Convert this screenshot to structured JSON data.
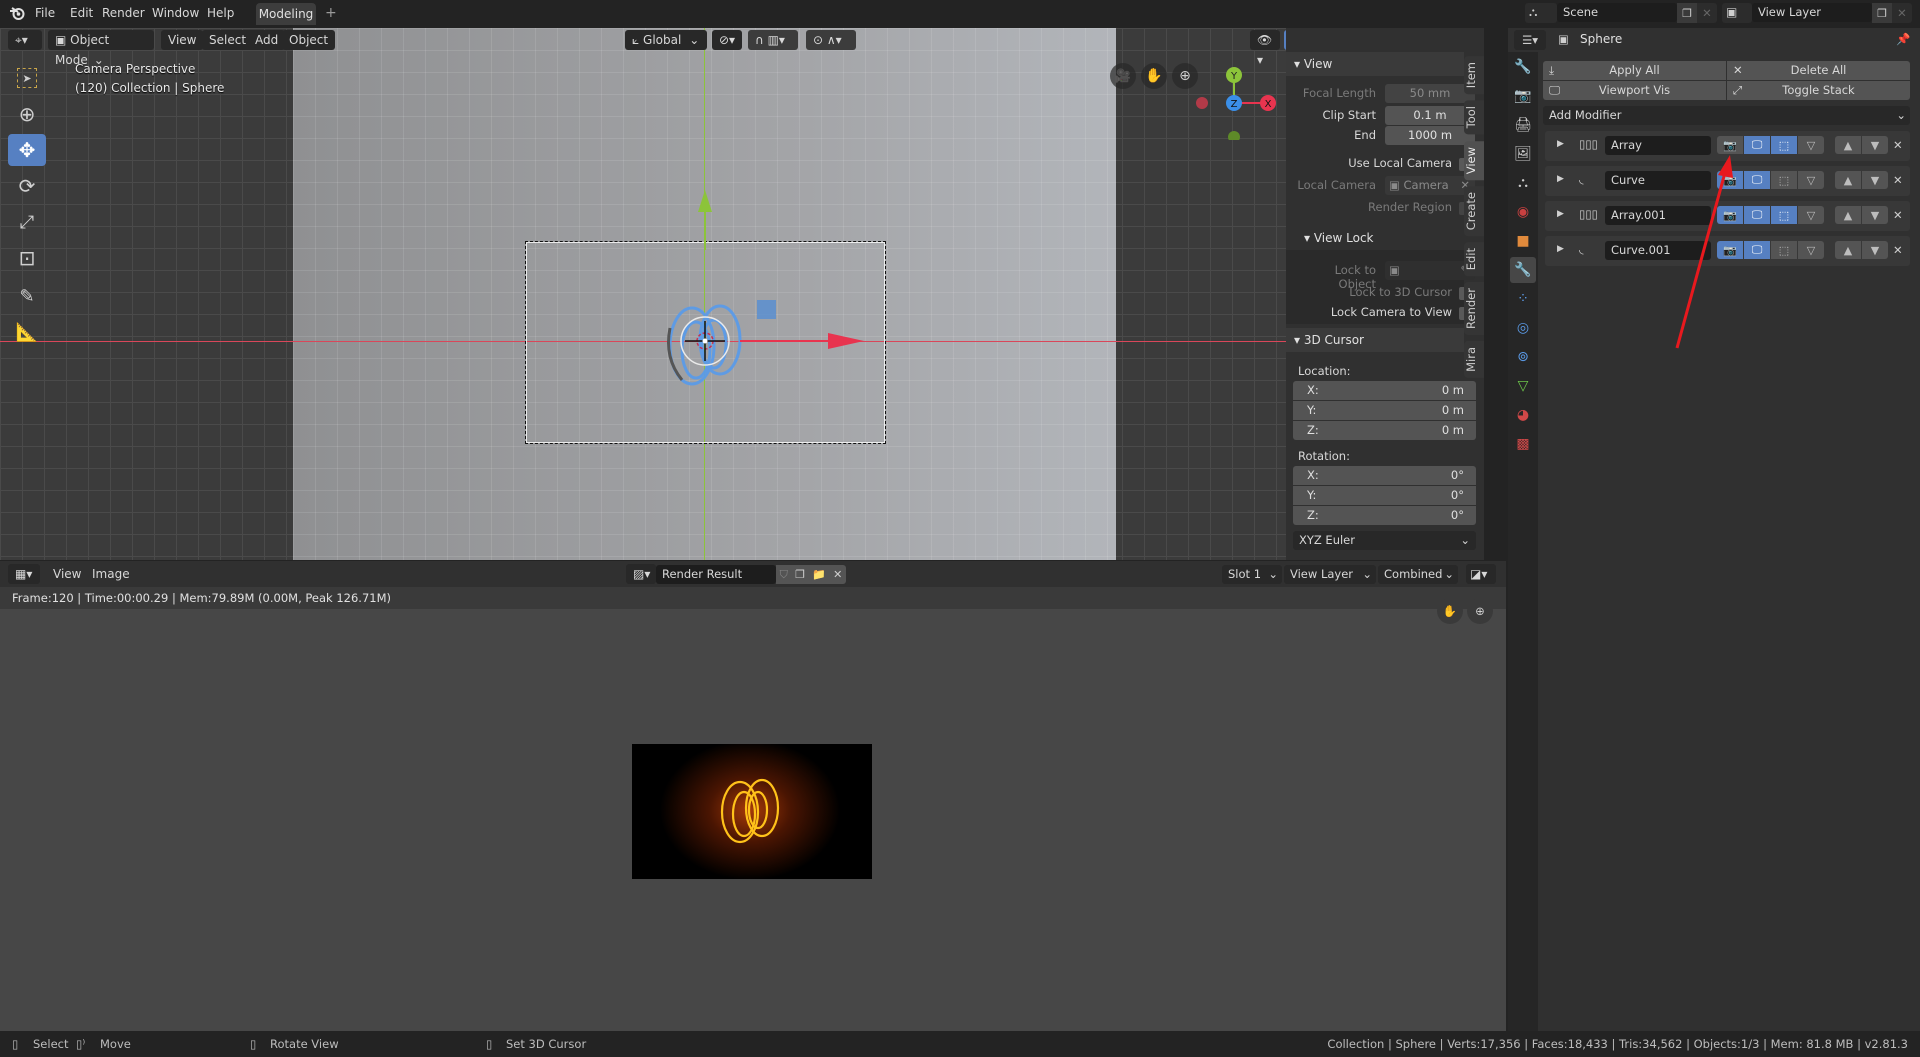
{
  "app": {
    "name": "Blender",
    "version": "v2.81.3"
  },
  "topbar": {
    "menus": [
      "File",
      "Edit",
      "Render",
      "Window",
      "Help"
    ],
    "workspace_tab": "Modeling",
    "add_workspace": "+",
    "scene": "Scene",
    "view_layer": "View Layer"
  },
  "viewport": {
    "mode": "Object Mode",
    "menus": [
      "View",
      "Select",
      "Add",
      "Object"
    ],
    "transform_orientation": "Global",
    "overlay_title": "Camera Perspective",
    "overlay_subtitle": "(120) Collection | Sphere",
    "gizmo_axes": {
      "x": "X",
      "y": "Y",
      "z": "Z"
    },
    "tools": [
      "select-box",
      "cursor",
      "move",
      "rotate",
      "scale",
      "transform",
      "annotate",
      "measure"
    ],
    "active_tool": "move"
  },
  "npanel": {
    "tabs": [
      "Item",
      "Tool",
      "View",
      "Create",
      "Edit",
      "Render",
      "Mira"
    ],
    "active_tab": "View",
    "view": {
      "title": "View",
      "focal_length_label": "Focal Length",
      "focal_length": "50 mm",
      "clip_start_label": "Clip Start",
      "clip_start": "0.1 m",
      "end_label": "End",
      "end": "1000 m",
      "use_local_camera": "Use Local Camera",
      "local_camera_label": "Local Camera",
      "local_camera": "Camera",
      "render_region": "Render Region"
    },
    "view_lock": {
      "title": "View Lock",
      "lock_to_object": "Lock to Object",
      "lock_to_3d_cursor": "Lock to 3D Cursor",
      "lock_camera_to_view": "Lock Camera to View"
    },
    "cursor": {
      "title": "3D Cursor",
      "location_label": "Location:",
      "location": [
        {
          "axis": "X:",
          "value": "0 m"
        },
        {
          "axis": "Y:",
          "value": "0 m"
        },
        {
          "axis": "Z:",
          "value": "0 m"
        }
      ],
      "rotation_label": "Rotation:",
      "rotation": [
        {
          "axis": "X:",
          "value": "0°"
        },
        {
          "axis": "Y:",
          "value": "0°"
        },
        {
          "axis": "Z:",
          "value": "0°"
        }
      ],
      "rotation_mode": "XYZ Euler"
    }
  },
  "properties": {
    "object_name": "Sphere",
    "apply_all": "Apply All",
    "delete_all": "Delete All",
    "viewport_vis": "Viewport Vis",
    "toggle_stack": "Toggle Stack",
    "add_modifier": "Add Modifier",
    "modifiers": [
      {
        "name": "Array",
        "type": "array",
        "render": false,
        "viewport": true,
        "editmode": true,
        "cage": false
      },
      {
        "name": "Curve",
        "type": "curve",
        "render": true,
        "viewport": true,
        "editmode": false,
        "cage": false
      },
      {
        "name": "Array.001",
        "type": "array",
        "render": true,
        "viewport": true,
        "editmode": true,
        "cage": false
      },
      {
        "name": "Curve.001",
        "type": "curve",
        "render": true,
        "viewport": true,
        "editmode": false,
        "cage": false
      }
    ]
  },
  "image_editor": {
    "menus": [
      "View",
      "Image"
    ],
    "image_name": "Render Result",
    "slot": "Slot 1",
    "layer": "View Layer",
    "pass": "Combined",
    "render_info": "Frame:120 | Time:00:00.29 | Mem:79.89M (0.00M, Peak 126.71M)"
  },
  "statusbar": {
    "hints": [
      {
        "icon": "mouse-left-icon",
        "label": "Select"
      },
      {
        "icon": "mouse-drag-icon",
        "label": "Move"
      },
      {
        "icon": "mouse-middle-icon",
        "label": "Rotate View"
      },
      {
        "icon": "mouse-right-icon",
        "label": "Set 3D Cursor"
      }
    ],
    "stats": "Collection | Sphere | Verts:17,356 | Faces:18,433 | Tris:34,562 | Objects:1/3 | Mem: 81.8 MB | v2.81.3"
  },
  "colors": {
    "accent": "#5680c2",
    "x_axis": "#e8344f",
    "y_axis": "#7cc424",
    "z_axis": "#3b8fe8",
    "annotation_arrow": "#e8191e",
    "selection": "#5b9be8"
  }
}
